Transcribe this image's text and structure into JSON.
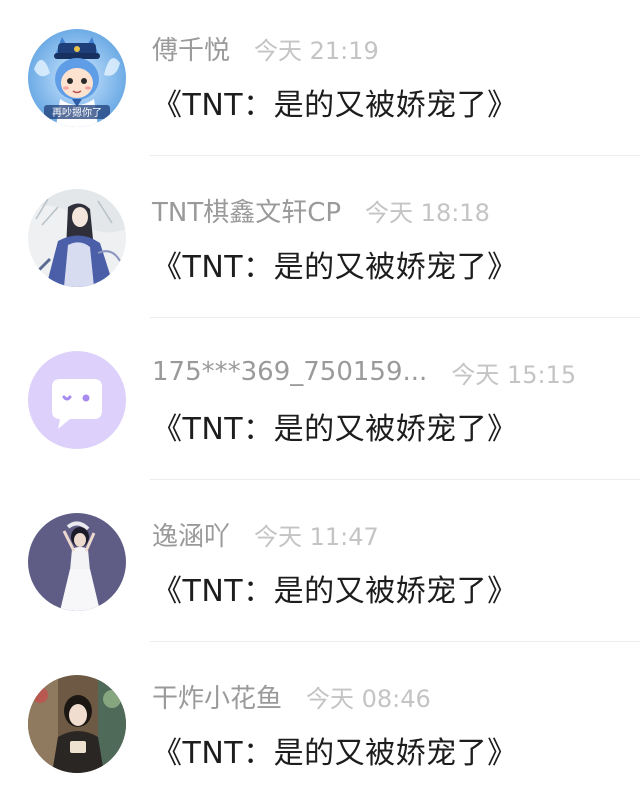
{
  "comments": [
    {
      "name": "傅千悦",
      "time": "今天 21:19",
      "text": "《TNT：是的又被娇宠了》",
      "avatar_icon": "anime-boy-avatar",
      "avatar_text": "再吵摁你了"
    },
    {
      "name": "TNT棋鑫文轩CP",
      "time": "今天 18:18",
      "text": "《TNT：是的又被娇宠了》",
      "avatar_icon": "ancient-costume-avatar"
    },
    {
      "name": "175***369_750159...",
      "time": "今天 15:15",
      "text": "《TNT：是的又被娇宠了》",
      "avatar_icon": "default-chat-bubble-avatar"
    },
    {
      "name": "逸涵吖",
      "time": "今天 11:47",
      "text": "《TNT：是的又被娇宠了》",
      "avatar_icon": "girl-white-dress-avatar"
    },
    {
      "name": "干炸小花鱼",
      "time": "今天 08:46",
      "text": "《TNT：是的又被娇宠了》",
      "avatar_icon": "girl-photo-avatar"
    }
  ],
  "colors": {
    "name": "#9a9a9a",
    "time": "#c4c4c4",
    "text": "#1d1d1d",
    "default_avatar_bg": "#ddd0fb",
    "default_avatar_bubble": "#ffffff",
    "default_avatar_dot": "#a78bf0"
  }
}
